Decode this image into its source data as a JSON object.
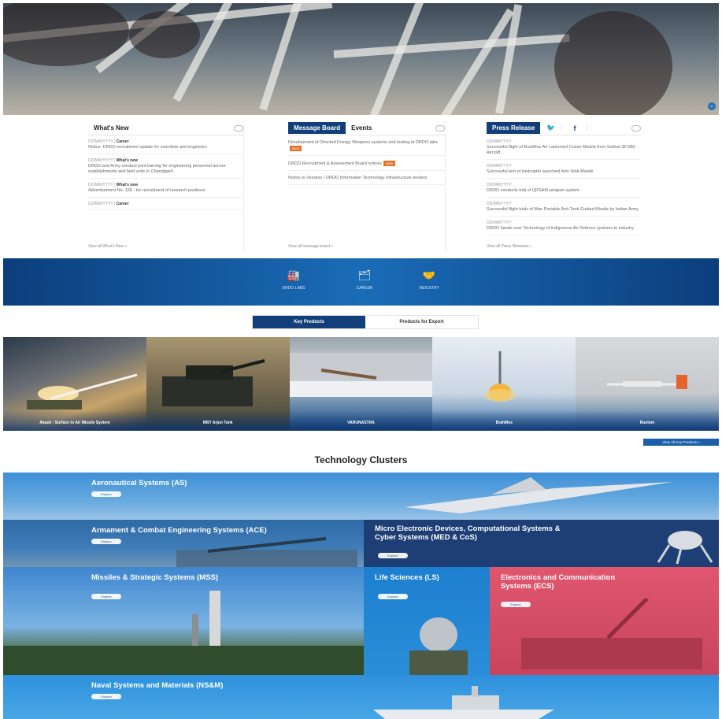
{
  "news": {
    "whats_new": {
      "tab": "What's New",
      "items": [
        {
          "date": "DD/MM/YYYY",
          "cat": "Career",
          "text": "Notice: DRDO recruitment update for scientists and engineers"
        },
        {
          "date": "DD/MM/YYYY",
          "cat": "What's new",
          "text": "DRDO and Army conduct joint training for engineering personnel across establishments and field units in Chandigarh"
        },
        {
          "date": "DD/MM/YYYY",
          "cat": "What's new",
          "text": "Advertisement No. 155 - for recruitment of research positions"
        },
        {
          "date": "DD/MM/YYYY",
          "cat": "Career",
          "text": ""
        }
      ],
      "more": "View all What's New »"
    },
    "message_board": {
      "tab_active": "Message Board",
      "tab_other": "Events",
      "items": [
        {
          "text": "Development of Directed Energy Weapons systems and testing at DRDO labs",
          "badge": "NEW"
        },
        {
          "text": "DRDO Recruitment & Assessment Board notices",
          "badge": "NEW"
        },
        {
          "text": "Notice to Vendors / DRDO Information Technology Infrastructure tenders",
          "badge": ""
        }
      ],
      "more": "View all message board »"
    },
    "press": {
      "tab": "Press Release",
      "twitter": "🐦",
      "facebook": "f",
      "items": [
        {
          "date": "DD/MM/YYYY",
          "text": "Successful flight of BrahMos Air Launched Cruise Missile from Sukhoi-30 MKI Aircraft"
        },
        {
          "date": "DD/MM/YYYY",
          "text": "Successful test of Helicopter launched Anti-Tank Missile"
        },
        {
          "date": "DD/MM/YYYY",
          "text": "DRDO conducts trial of QRSAM weapon system"
        },
        {
          "date": "DD/MM/YYYY",
          "text": "Successful flight trials of Man Portable Anti-Tank Guided Missile by Indian Army"
        },
        {
          "date": "DD/MM/YYYY",
          "text": "DRDO hands over Technology of indigenous Air Defence systems to industry"
        }
      ],
      "more": "View all Press Releases »"
    }
  },
  "quick_links": [
    {
      "icon": "🏭",
      "label": "DRDO LABS"
    },
    {
      "icon": "🗂",
      "label": "CAREER"
    },
    {
      "icon": "🤝",
      "label": "INDUSTRY"
    }
  ],
  "product_tabs": {
    "active": "Key Products",
    "other": "Products for Export"
  },
  "products": [
    {
      "name": "Akash - Surface to Air Missile System"
    },
    {
      "name": "MBT Arjun Tank"
    },
    {
      "name": "VARUNASTRA"
    },
    {
      "name": "BrahMos"
    },
    {
      "name": "Rustom"
    }
  ],
  "view_all_products": "View All Key Products »",
  "tech_title": "Technology Clusters",
  "clusters": [
    {
      "title": "Aeronautical Systems (AS)",
      "btn": "Explore"
    },
    {
      "title": "Armament & Combat Engineering Systems (ACE)",
      "btn": "Explore"
    },
    {
      "title": "Micro Electronic Devices, Computational Systems & Cyber Systems (MED & CoS)",
      "btn": "Explore"
    },
    {
      "title": "Missiles & Strategic Systems (MSS)",
      "btn": "Explore"
    },
    {
      "title": "Life Sciences (LS)",
      "btn": "Explore"
    },
    {
      "title": "Electronics and Communication Systems (ECS)",
      "btn": "Explore"
    },
    {
      "title": "Naval Systems and Materials (NS&M)",
      "btn": "Explore"
    }
  ],
  "colors": {
    "navy": "#123f79",
    "blue": "#1a6cb7",
    "pink": "#d94866",
    "orange": "#e8702a"
  }
}
